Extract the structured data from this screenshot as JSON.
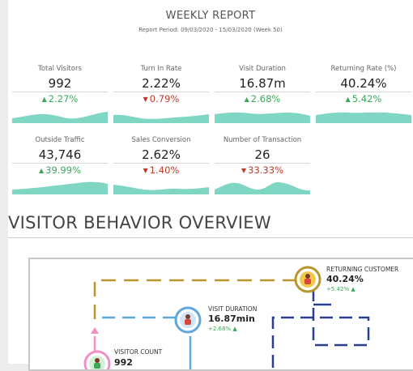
{
  "report": {
    "title": "WEEKLY REPORT",
    "period": "Report Period: 09/03/2020 - 15/03/2020 (Week 50)"
  },
  "metrics": [
    {
      "label": "Total Visitors",
      "value": "992",
      "change": "2.27%",
      "direction": "up"
    },
    {
      "label": "Turn In Rate",
      "value": "2.22%",
      "change": "0.79%",
      "direction": "down"
    },
    {
      "label": "Visit Duration",
      "value": "16.87m",
      "change": "2.68%",
      "direction": "up"
    },
    {
      "label": "Returning Rate (%)",
      "value": "40.24%",
      "change": "5.42%",
      "direction": "up"
    },
    {
      "label": "Outside Traffic",
      "value": "43,746",
      "change": "39.99%",
      "direction": "up"
    },
    {
      "label": "Sales Conversion",
      "value": "2.62%",
      "change": "1.40%",
      "direction": "down"
    },
    {
      "label": "Number of Transaction",
      "value": "26",
      "change": "33.33%",
      "direction": "down"
    }
  ],
  "section": {
    "title": "VISITOR BEHAVIOR OVERVIEW"
  },
  "flow": {
    "returning": {
      "label": "RETURNING CUSTOMER",
      "value": "40.24%",
      "change": "+5.42%"
    },
    "duration": {
      "label": "VISIT DURATION",
      "value": "16.87min",
      "change": "+2.68%"
    },
    "count": {
      "label": "VISITOR COUNT",
      "value": "992"
    }
  },
  "colors": {
    "up": "#3ea85a",
    "down": "#c0392b",
    "sparkline": "#7fd6c2",
    "gold": "#b8962e",
    "light_blue": "#5fa8dc",
    "navy": "#2a3f8f",
    "pink": "#f28fc4"
  },
  "icons": {
    "up": "▲",
    "down": "▼"
  }
}
